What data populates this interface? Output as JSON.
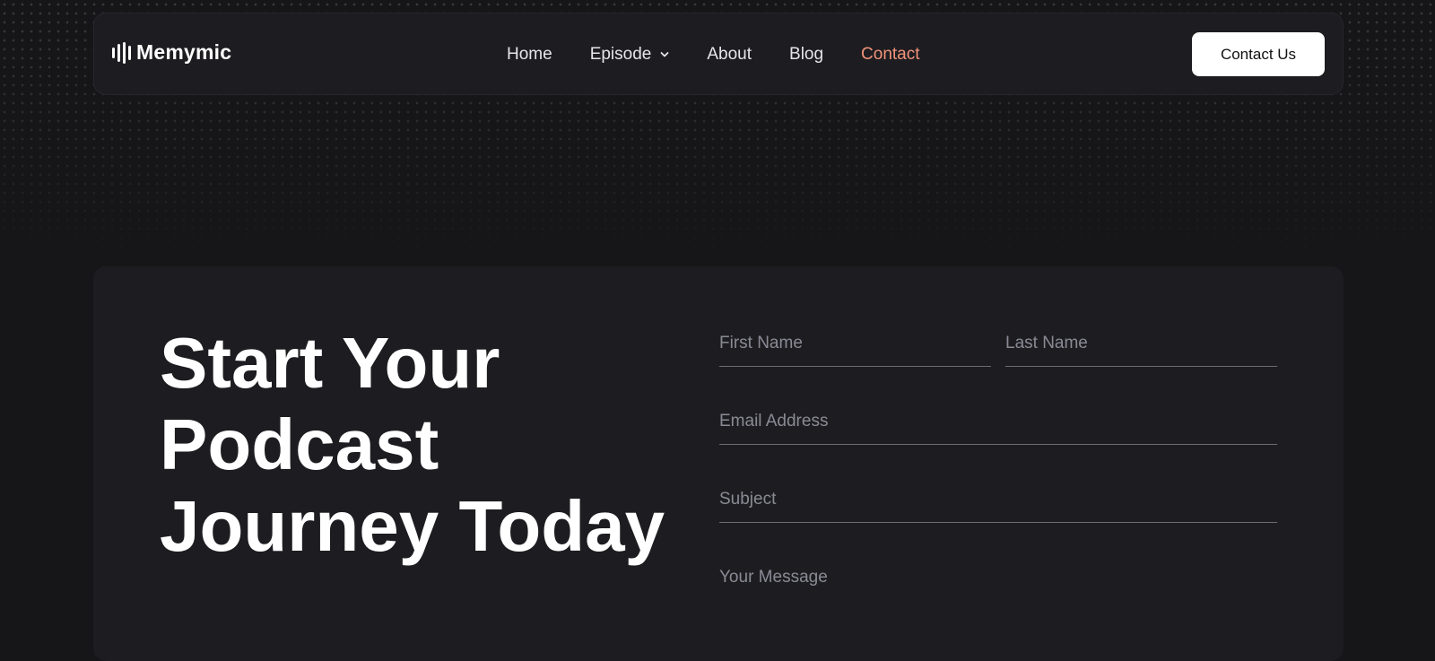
{
  "brand": {
    "name": "Memymic",
    "icon": "sound-wave-icon"
  },
  "nav": {
    "items": [
      {
        "label": "Home"
      },
      {
        "label": "Episode",
        "icon": "chevron-down-icon"
      },
      {
        "label": "About"
      },
      {
        "label": "Blog"
      },
      {
        "label": "Contact",
        "active": true
      }
    ],
    "cta_label": "Contact Us"
  },
  "hero": {
    "heading_lines": [
      "Start Your",
      "Podcast",
      "Journey Today"
    ]
  },
  "form": {
    "first_name_placeholder": "First Name",
    "last_name_placeholder": "Last Name",
    "email_placeholder": "Email Address",
    "subject_placeholder": "Subject",
    "message_placeholder": "Your Message"
  },
  "colors": {
    "background": "#161619",
    "panel": "#1d1d21",
    "accent": "#f2937a",
    "text": "#ffffff",
    "placeholder": "#8a8a95"
  }
}
